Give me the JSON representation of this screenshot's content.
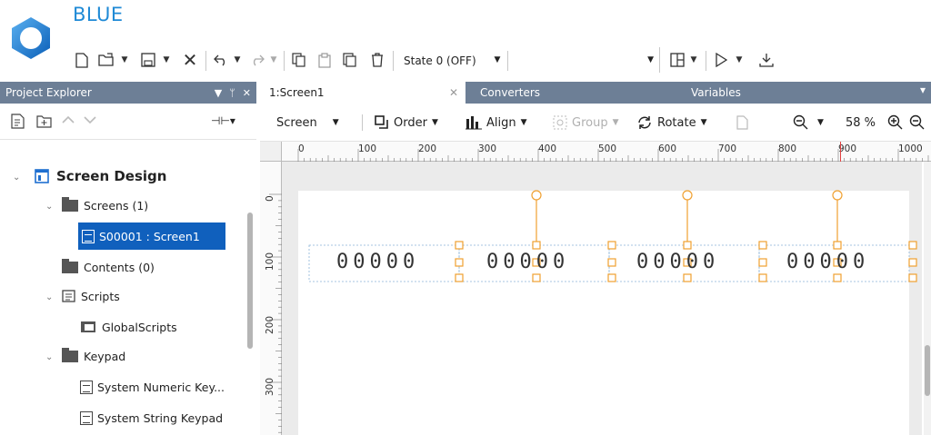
{
  "app": {
    "brand": "BLUE"
  },
  "toolbar": {
    "state_label": "State 0 (OFF)",
    "icons": [
      "new-file-icon",
      "open-folder-icon",
      "save-icon",
      "delete-icon",
      "undo-icon",
      "redo-icon",
      "copy-icon",
      "paste-icon",
      "duplicate-icon",
      "trash-icon",
      "layout-icon",
      "run-icon",
      "download-icon"
    ]
  },
  "explorer": {
    "title": "Project Explorer",
    "tree": {
      "screen_design": "Screen Design",
      "screens": "Screens (1)",
      "screen1": "S00001 : Screen1",
      "contents": "Contents (0)",
      "scripts": "Scripts",
      "global_scripts": "GlobalScripts",
      "keypad": "Keypad",
      "numeric_keypad": "System Numeric Key...",
      "string_keypad": "System String Keypad"
    }
  },
  "tabs": [
    {
      "label": "1:Screen1"
    },
    {
      "label": "Converters"
    },
    {
      "label": "Variables"
    }
  ],
  "screen_toolbar": {
    "screen": "Screen",
    "order": "Order",
    "align": "Align",
    "group": "Group",
    "rotate": "Rotate",
    "zoom": "58 %"
  },
  "rulers": {
    "h": [
      "0",
      "100",
      "200",
      "300",
      "400",
      "500",
      "600",
      "700",
      "800",
      "900",
      "1000"
    ],
    "v": [
      "0",
      "100",
      "200",
      "300"
    ]
  },
  "canvas": {
    "display_groups": [
      {
        "digits": "00000"
      },
      {
        "digits": "00000"
      },
      {
        "digits": "00000"
      },
      {
        "digits": "00000"
      }
    ]
  },
  "colors": {
    "accent": "#1f8ad6",
    "header": "#6d7f96",
    "selected": "#1060bd",
    "handle": "#f0a030"
  }
}
